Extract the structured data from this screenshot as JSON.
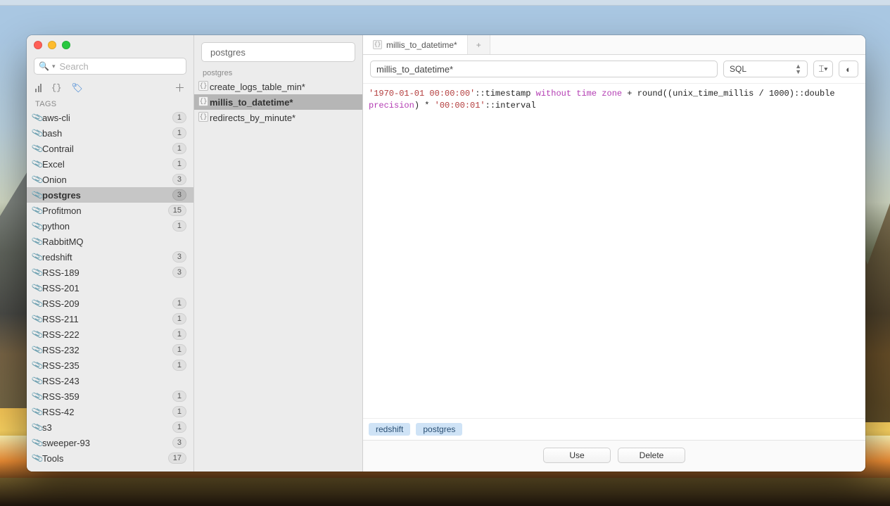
{
  "search": {
    "placeholder": "Search"
  },
  "sections": {
    "tags_label": "TAGS"
  },
  "tags": [
    {
      "name": "aws-cli",
      "count": 1
    },
    {
      "name": "bash",
      "count": 1
    },
    {
      "name": "Contrail",
      "count": 1
    },
    {
      "name": "Excel",
      "count": 1
    },
    {
      "name": "Onion",
      "count": 3
    },
    {
      "name": "postgres",
      "count": 3,
      "selected": true
    },
    {
      "name": "Profitmon",
      "count": 15
    },
    {
      "name": "python",
      "count": 1
    },
    {
      "name": "RabbitMQ"
    },
    {
      "name": "redshift",
      "count": 3
    },
    {
      "name": "RSS-189",
      "count": 3
    },
    {
      "name": "RSS-201"
    },
    {
      "name": "RSS-209",
      "count": 1
    },
    {
      "name": "RSS-211",
      "count": 1
    },
    {
      "name": "RSS-222",
      "count": 1
    },
    {
      "name": "RSS-232",
      "count": 1
    },
    {
      "name": "RSS-235",
      "count": 1
    },
    {
      "name": "RSS-243"
    },
    {
      "name": "RSS-359",
      "count": 1
    },
    {
      "name": "RSS-42",
      "count": 1
    },
    {
      "name": "s3",
      "count": 1
    },
    {
      "name": "sweeper-93",
      "count": 3
    },
    {
      "name": "Tools",
      "count": 17
    }
  ],
  "snippets": {
    "filter_label": "postgres",
    "group_label": "postgres",
    "items": [
      {
        "title": "create_logs_table_min*"
      },
      {
        "title": "millis_to_datetime*",
        "selected": true
      },
      {
        "title": "redirects_by_minute*"
      }
    ]
  },
  "editor": {
    "tab_title": "millis_to_datetime*",
    "new_tab_glyph": "+",
    "title_value": "millis_to_datetime*",
    "language": "SQL",
    "code": {
      "p1": "'1970-01-01 00:00:00'",
      "p2": "::timestamp ",
      "kw1": "without",
      "sp1": " ",
      "kw2": "time",
      "sp2": " ",
      "kw3": "zone",
      "p3": " + round((unix_time_millis / 1000)::double ",
      "kw4": "precision",
      "p4": ") * ",
      "p5": "'00:00:01'",
      "p6": "::interval"
    },
    "chips": [
      "redshift",
      "postgres"
    ],
    "buttons": {
      "use": "Use",
      "delete": "Delete"
    }
  }
}
